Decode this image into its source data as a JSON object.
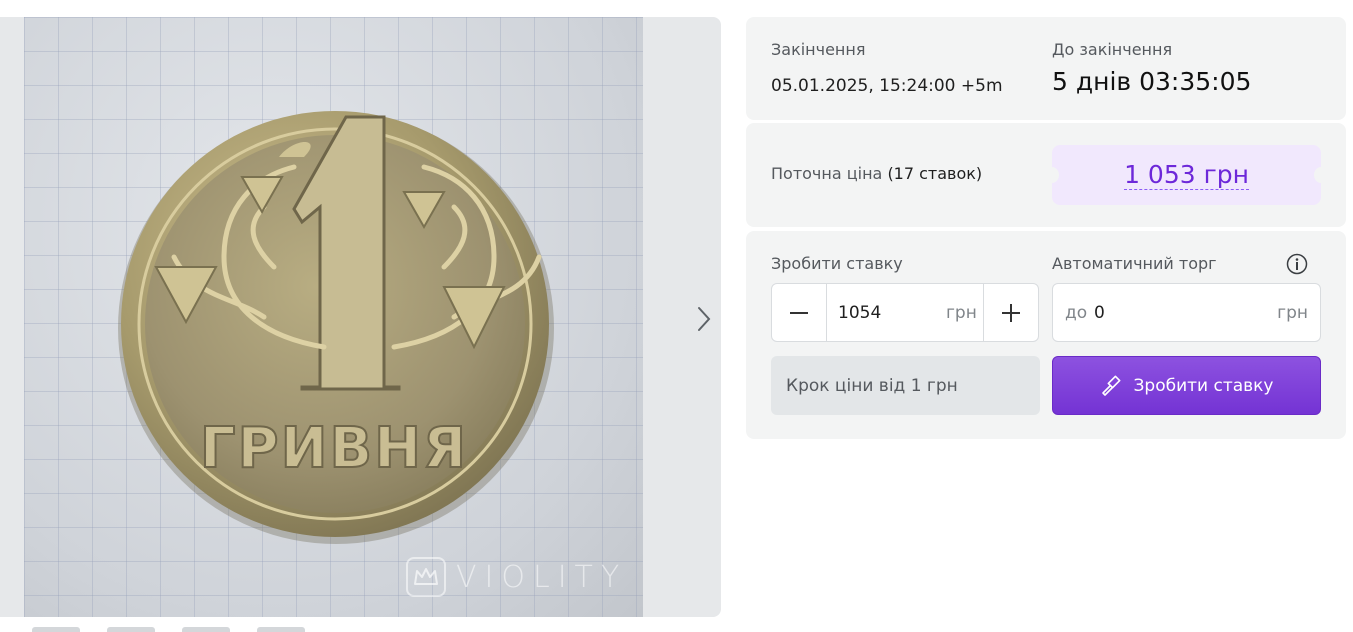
{
  "gallery": {
    "watermark": "VIOLITY",
    "coin_text": [
      "1",
      "ГРИВНЯ"
    ],
    "icons": {
      "next": "chevron-right-icon",
      "watermark": "crown-icon"
    }
  },
  "timer": {
    "end_label": "Закінчення",
    "end_value": "05.01.2025, 15:24:00 +5m",
    "left_label": "До закінчення",
    "left_value": "5 днів 03:35:05"
  },
  "price": {
    "label": "Поточна ціна",
    "bids_count": "(17 ставок)",
    "value": "1 053 грн",
    "accent": "#6d28d9"
  },
  "bid": {
    "label": "Зробити ставку",
    "value": "1054",
    "unit": "грн",
    "step_note": "Крок ціни від 1 грн",
    "button_label": "Зробити ставку",
    "icons": {
      "minus": "minus-icon",
      "plus": "plus-icon",
      "button": "gavel-icon"
    }
  },
  "auto": {
    "label": "Автоматичний торг",
    "prefix": "до",
    "value": "0",
    "unit": "грн",
    "icon": "info-icon"
  }
}
